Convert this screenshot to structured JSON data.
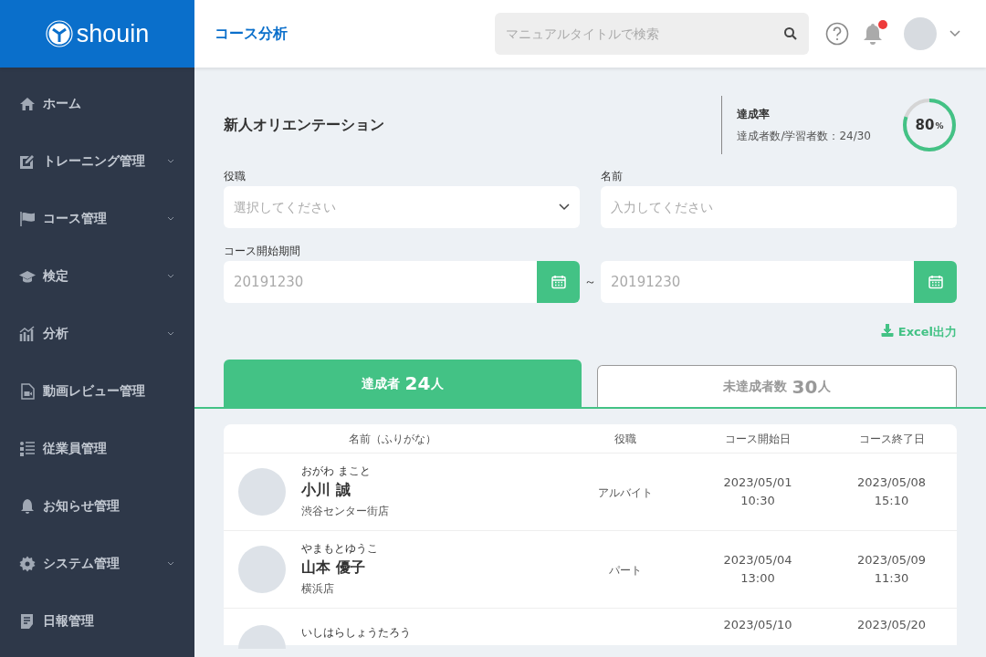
{
  "logo": {
    "text": "shouin"
  },
  "header": {
    "title": "コース分析",
    "search": {
      "placeholder": "マニュアルタイトルで検索"
    },
    "notification_dot": true
  },
  "sidebar": {
    "items": [
      {
        "label": "ホーム",
        "has_submenu": false
      },
      {
        "label": "トレーニング管理",
        "has_submenu": true
      },
      {
        "label": "コース管理",
        "has_submenu": true
      },
      {
        "label": "検定",
        "has_submenu": true
      },
      {
        "label": "分析",
        "has_submenu": true
      },
      {
        "label": "動画レビュー管理",
        "has_submenu": false
      },
      {
        "label": "従業員管理",
        "has_submenu": false
      },
      {
        "label": "お知らせ管理",
        "has_submenu": false
      },
      {
        "label": "システム管理",
        "has_submenu": true
      },
      {
        "label": "日報管理",
        "has_submenu": false
      }
    ]
  },
  "course": {
    "title": "新人オリエンテーション",
    "rate_label": "達成率",
    "rate_detail": "達成者数/学習者数：24/30",
    "rate_value": "80",
    "rate_unit": "%",
    "level": 0.8
  },
  "filters": {
    "position": {
      "label": "役職",
      "placeholder": "選択してください"
    },
    "name": {
      "label": "名前",
      "placeholder": "入力してください"
    },
    "period": {
      "label": "コース開始期間",
      "from": "20191230",
      "separator": "～",
      "to": "20191230"
    }
  },
  "export": {
    "label": "Excel出力"
  },
  "tabs": [
    {
      "label": "達成者",
      "count": "24",
      "unit": "人",
      "selected": true
    },
    {
      "label": "未達成者数",
      "count": "30",
      "unit": "人",
      "selected": false
    }
  ],
  "table": {
    "columns": [
      "名前（ふりがな）",
      "役職",
      "コース開始日",
      "コース終了日"
    ],
    "rows": [
      {
        "furigana": "おがわ まこと",
        "name": "小川 誠",
        "store": "渋谷センター街店",
        "position": "アルバイト",
        "start_date": "2023/05/01",
        "start_time": "10:30",
        "end_date": "2023/05/08",
        "end_time": "15:10"
      },
      {
        "furigana": "やまもとゆうこ",
        "name": "山本 優子",
        "store": "横浜店",
        "position": "パート",
        "start_date": "2023/05/04",
        "start_time": "13:00",
        "end_date": "2023/05/09",
        "end_time": "11:30"
      },
      {
        "furigana": "いしはらしょうたろう",
        "start_date": "2023/05/10",
        "end_date": "2023/05/20"
      }
    ]
  }
}
